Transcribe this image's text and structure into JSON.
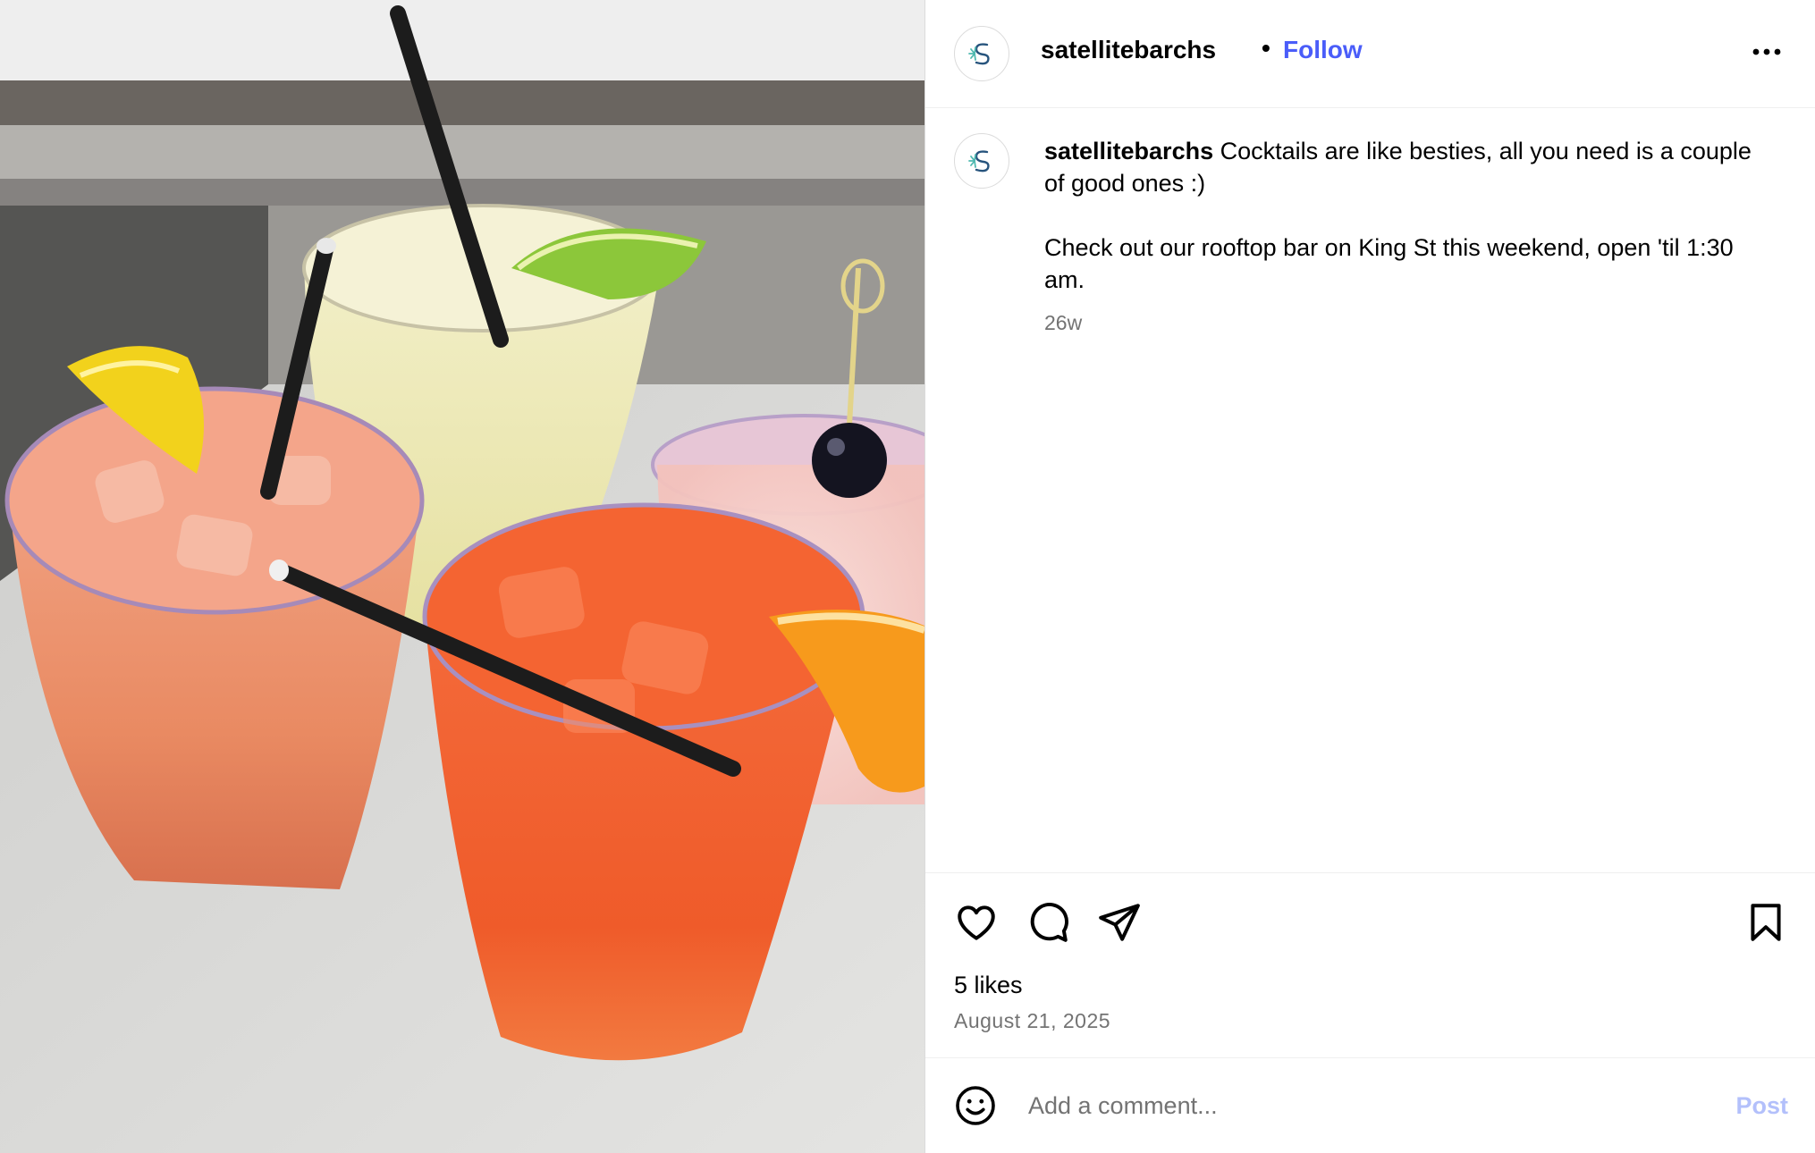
{
  "post": {
    "author": "satellitebarchs",
    "follow_label": "Follow",
    "caption": "Cocktails are like besties, all you need is a couple of good ones :)",
    "caption_line2": "Check out our rooftop bar on King St this weekend, open 'til 1:30 am.",
    "time_ago": "26w",
    "likes": "5 likes",
    "date": "August 21, 2025"
  },
  "comment": {
    "placeholder": "Add a comment...",
    "post_label": "Post"
  },
  "icons": {
    "more": "more-options-icon",
    "like": "heart-icon",
    "comment": "comment-bubble-icon",
    "share": "paper-plane-icon",
    "save": "bookmark-icon",
    "emoji": "smiley-icon"
  },
  "colors": {
    "follow": "#4a5df9",
    "post_button": "#b3c0fb",
    "secondary_text": "#737373"
  }
}
